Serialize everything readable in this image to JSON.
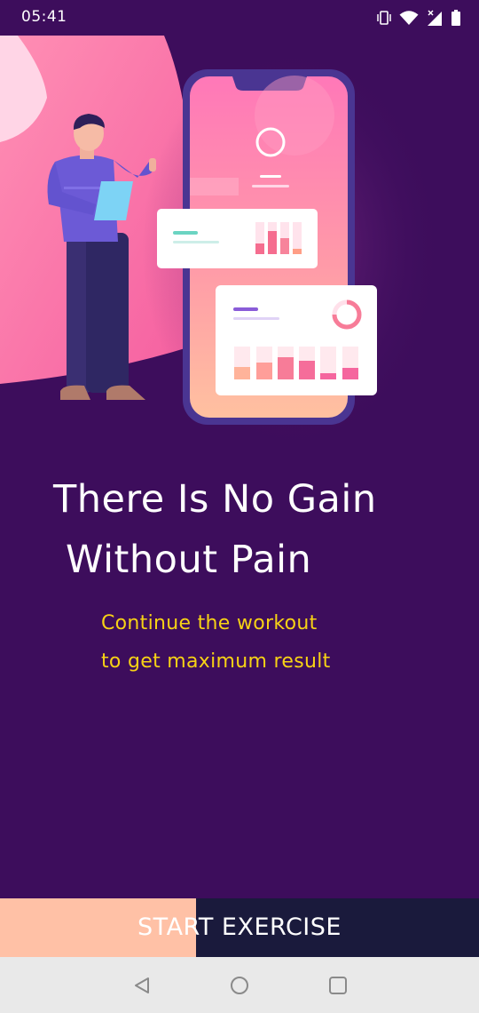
{
  "status_bar": {
    "time": "05:41",
    "icons": [
      "vibrate-icon",
      "wifi-icon",
      "signal-icon",
      "battery-icon"
    ]
  },
  "hero": {
    "illustration": "man-with-clipboard-and-phone-dashboard"
  },
  "headline": {
    "line1": "There Is No Gain",
    "line2": "Without Pain"
  },
  "subtitle": {
    "line1": "Continue the workout",
    "line2": "to get maximum result"
  },
  "start_button": {
    "label": "START EXERCISE",
    "progress": 0.41
  },
  "nav_bar": {
    "icons": [
      "back-icon",
      "home-icon",
      "recents-icon"
    ]
  },
  "colors": {
    "background": "#3d0d5c",
    "accent_yellow": "#f7d215",
    "button_dark": "#1a1a3c",
    "button_progress": "#ffc1a6",
    "nav_bar": "#e9e9e9"
  }
}
